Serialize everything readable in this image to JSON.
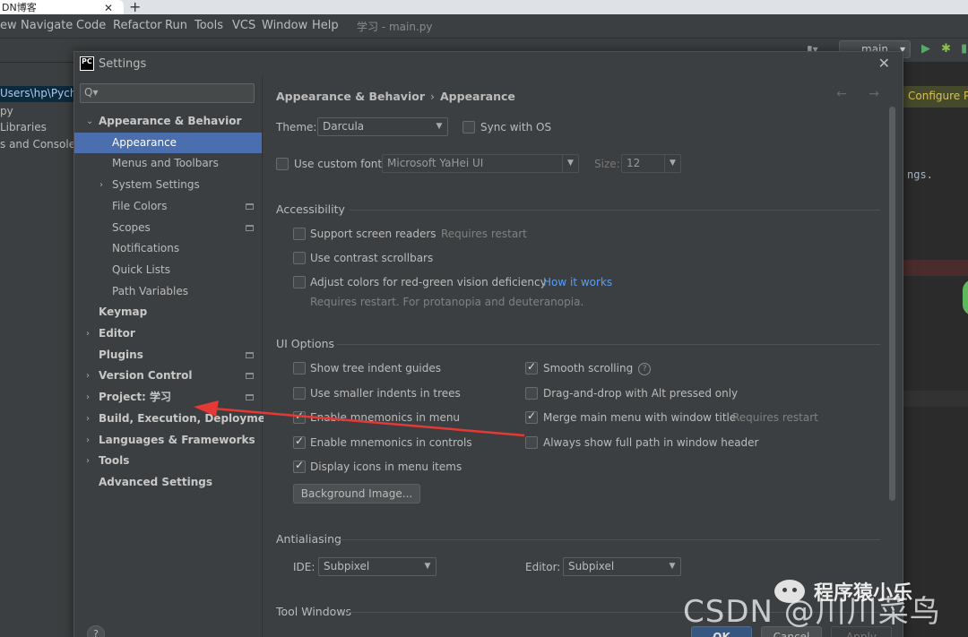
{
  "browser_tab": {
    "title": "DN博客",
    "close": "✕",
    "new": "+"
  },
  "menubar": {
    "items": [
      "ew",
      "Navigate",
      "Code",
      "Refactor",
      "Run",
      "Tools",
      "VCS",
      "Window",
      "Help"
    ],
    "title": "学习 - main.py"
  },
  "ide_toolbar": {
    "run_config": "main",
    "hash": "▮▾"
  },
  "project_panel": {
    "lines": [
      "Users\\hp\\Pycha",
      "py",
      "Libraries",
      "s and Consoles"
    ]
  },
  "editor": {
    "configure_label": "Configure Py",
    "code_fragment": "ngs."
  },
  "dialog": {
    "title": "Settings",
    "icon_text": "PC",
    "close": "✕",
    "search_placeholder": "Q▾",
    "tree": [
      {
        "label": "Appearance & Behavior",
        "level": 0,
        "arrow": "⌄",
        "bold": true
      },
      {
        "label": "Appearance",
        "level": 1,
        "selected": true
      },
      {
        "label": "Menus and Toolbars",
        "level": 1
      },
      {
        "label": "System Settings",
        "level": 1,
        "arrow": "›"
      },
      {
        "label": "File Colors",
        "level": 1,
        "project_icon": true
      },
      {
        "label": "Scopes",
        "level": 1,
        "project_icon": true
      },
      {
        "label": "Notifications",
        "level": 1
      },
      {
        "label": "Quick Lists",
        "level": 1
      },
      {
        "label": "Path Variables",
        "level": 1
      },
      {
        "label": "Keymap",
        "level": 0,
        "bold": true
      },
      {
        "label": "Editor",
        "level": 0,
        "arrow": "›",
        "bold": true
      },
      {
        "label": "Plugins",
        "level": 0,
        "bold": true,
        "project_icon": true
      },
      {
        "label": "Version Control",
        "level": 0,
        "arrow": "›",
        "bold": true,
        "project_icon": true
      },
      {
        "label": "Project: 学习",
        "level": 0,
        "arrow": "›",
        "bold": true,
        "project_icon": true
      },
      {
        "label": "Build, Execution, Deployment",
        "level": 0,
        "arrow": "›",
        "bold": true
      },
      {
        "label": "Languages & Frameworks",
        "level": 0,
        "arrow": "›",
        "bold": true
      },
      {
        "label": "Tools",
        "level": 0,
        "arrow": "›",
        "bold": true
      },
      {
        "label": "Advanced Settings",
        "level": 0,
        "bold": true
      }
    ],
    "breadcrumb": {
      "parent": "Appearance & Behavior",
      "sep": "›",
      "current": "Appearance"
    },
    "nav_arrows": "← →",
    "theme": {
      "label": "Theme:",
      "value": "Darcula",
      "sync_label": "Sync with OS",
      "sync_checked": false
    },
    "font": {
      "use_custom_label": "Use custom font:",
      "use_custom_checked": false,
      "font_value": "Microsoft YaHei UI",
      "size_label": "Size:",
      "size_value": "12"
    },
    "accessibility": {
      "title": "Accessibility",
      "screen_readers": {
        "label": "Support screen readers",
        "hint": "Requires restart",
        "checked": false
      },
      "contrast_scrollbars": {
        "label": "Use contrast scrollbars",
        "checked": false
      },
      "red_green": {
        "label": "Adjust colors for red-green vision deficiency",
        "link": "How it works",
        "hint": "Requires restart. For protanopia and deuteranopia.",
        "checked": false
      }
    },
    "ui_options": {
      "title": "UI Options",
      "left": [
        {
          "label": "Show tree indent guides",
          "checked": false
        },
        {
          "label": "Use smaller indents in trees",
          "checked": false
        },
        {
          "label": "Enable mnemonics in menu",
          "checked": true
        },
        {
          "label": "Enable mnemonics in controls",
          "checked": true
        },
        {
          "label": "Display icons in menu items",
          "checked": true
        }
      ],
      "right": [
        {
          "label": "Smooth scrolling",
          "checked": true,
          "help": "?"
        },
        {
          "label": "Drag-and-drop with Alt pressed only",
          "checked": false
        },
        {
          "label": "Merge main menu with window title",
          "checked": true,
          "hint": "Requires restart"
        },
        {
          "label": "Always show full path in window header",
          "checked": false
        }
      ],
      "background_button": "Background Image..."
    },
    "antialiasing": {
      "title": "Antialiasing",
      "ide_label": "IDE:",
      "ide_value": "Subpixel",
      "editor_label": "Editor:",
      "editor_value": "Subpixel"
    },
    "tool_windows": {
      "title": "Tool Windows"
    },
    "buttons": {
      "help": "?",
      "ok": "OK",
      "cancel": "Cancel",
      "apply": "Apply"
    }
  },
  "watermark": {
    "csdn": "CSDN @川川菜鸟",
    "wechat": "程序猿小乐"
  },
  "colors": {
    "accent": "#4b6eaf",
    "annotation_arrow": "#e53935",
    "link": "#589df6"
  }
}
